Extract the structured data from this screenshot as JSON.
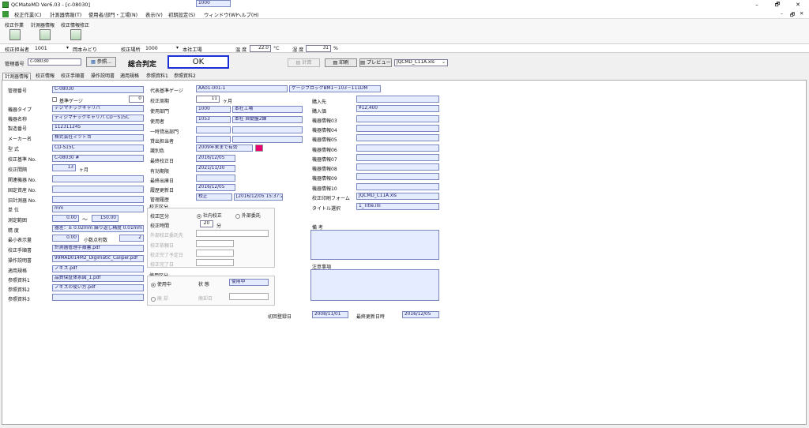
{
  "window": {
    "title": "QCMateMD Ver6.03 - [c-08030]",
    "controls": [
      "–",
      "🗗",
      "✕"
    ],
    "inner_controls": [
      "–",
      "🗗",
      "✕"
    ]
  },
  "menu": [
    "校正作業(C)",
    "計測器情報(T)",
    "使用者/部門・工場(N)",
    "表示(V)",
    "初期設定(S)",
    "ウィンドウ(W)",
    "ヘルプ(H)"
  ],
  "toolbar_tabs": [
    "校正作業",
    "計測器情報",
    "校正情報修正"
  ],
  "status": {
    "operator_label": "校正担当者",
    "operator_id": "1001",
    "operator_name": "岡本みどり",
    "place_label": "校正場所",
    "place_id": "1000",
    "place_name": "本社工場",
    "temp_label": "温 度",
    "temp_value": "22.0",
    "temp_unit": "°C",
    "humidity_label": "湿 度",
    "humidity_value": "31",
    "humidity_unit": "%"
  },
  "header": {
    "mgmt_no_label": "管理番号",
    "mgmt_no_value": "c-08030",
    "ref_button": "参照...",
    "judgment_label": "総合判定",
    "judgment_value": "OK",
    "calc_button": "計算",
    "print_button": "印刷",
    "preview_button": "プレビュー",
    "form_select": "JQCMD_C11A.xls"
  },
  "tabs": [
    "計測器情報",
    "校正情報",
    "校正手順書",
    "操作説明書",
    "適用規格",
    "参照資料1",
    "参照資料2"
  ],
  "left": {
    "mgmt_no": {
      "label": "管理番号",
      "value": "C-08030"
    },
    "master_gauge": {
      "label": "基準ゲージ",
      "value": "0"
    },
    "type": {
      "label": "機器タイプ",
      "value": "デジマチックキャリパ"
    },
    "name": {
      "label": "機器名称",
      "value": "ディジマチックキャリパ CD－S15C"
    },
    "serial": {
      "label": "製造番号",
      "value": "112311245"
    },
    "maker": {
      "label": "メーカー名",
      "value": "株式会社ミツトヨ"
    },
    "model": {
      "label": "型 式",
      "value": "CD-S15C"
    },
    "std_no": {
      "label": "校正基準 No.",
      "value": "C-08030 #"
    },
    "interval": {
      "label": "校正間隔",
      "value": "13",
      "unit": "ヶ月"
    },
    "related": {
      "label": "関連機器 No.",
      "value": ""
    },
    "asset": {
      "label": "固定資産 No.",
      "value": ""
    },
    "old_no": {
      "label": "旧計測器 No.",
      "value": ""
    },
    "unit": {
      "label": "単 位",
      "value": "mm"
    },
    "range": {
      "label": "測定範囲",
      "from": "0.00",
      "sep": "～",
      "to": "150.00"
    },
    "accuracy": {
      "label": "精 度",
      "value": "器差：± 0.02mm 繰り返し精度 0.01mm"
    },
    "min_disp": {
      "label": "最小表示量",
      "value": "0.00",
      "dec_label": "小数点桁数",
      "dec_value": "2"
    },
    "procedure": {
      "label": "校正手順書",
      "value": "計測器管理手順書.pdf"
    },
    "manual": {
      "label": "操作説明書",
      "value": "99MAD014M2_Digimatic_Caliper.pdf"
    },
    "standard": {
      "label": "適用規格",
      "value": "ノギス.pdf"
    },
    "ref1": {
      "label": "参照資料1",
      "value": "品質保証体系図_1.pdf"
    },
    "ref2": {
      "label": "参照資料2",
      "value": "ノギスの使い方.pdf"
    },
    "ref3": {
      "label": "参照資料3",
      "value": ""
    }
  },
  "middle": {
    "rep_gauge": {
      "label": "代表基準ゲージ",
      "value": "AA01-001-1",
      "value2": "ゲージブロックBM1－103－111DM"
    },
    "cal_period": {
      "label": "校正周期",
      "value": "11",
      "unit": "ヶ月"
    },
    "dept": {
      "label": "使用部門",
      "id": "1000",
      "name": "本社工場"
    },
    "user": {
      "label": "使用者",
      "id": "1053",
      "name": "本社 自動盤2課"
    },
    "lend_dept": {
      "label": "一時貸出部門"
    },
    "lend_person": {
      "label": "貸出担当者"
    },
    "ident_color": {
      "label": "識別色",
      "value": "2009年末まで有効",
      "color": "#e8006e"
    },
    "last_cal": {
      "label": "最終校正日",
      "value": "2016/12/05"
    },
    "expiry": {
      "label": "有効期限",
      "value": "2021/11/30"
    },
    "last_out": {
      "label": "最終出庫日",
      "value": ""
    },
    "history_update": {
      "label": "履歴更新日",
      "value": "2016/12/05"
    },
    "history": {
      "label": "管理履歴",
      "value": "校正",
      "value2": "[2016/12/05 15:37:24] 初回訪…"
    },
    "cal_group": {
      "title": "校正区分",
      "kind_label": "校正区分",
      "opt_internal": "社内校正",
      "opt_external": "外部委託",
      "time_label": "校正時間",
      "time_value": "20",
      "time_unit": "分",
      "ext_contractor": "外部校正委託先",
      "ordered": "校正依頼日",
      "due": "校正完了予定日",
      "done": "校正完了日"
    },
    "use_group": {
      "title": "使用区分",
      "opt_use": "使用中",
      "state_label": "状 態",
      "state_value": "使用中",
      "opt_disposed": "廃 却",
      "disposed_label": "廃却日"
    },
    "first_reg": {
      "label": "初回登録日",
      "value": "2008/11/01"
    },
    "last_update": {
      "label": "最終更新日時",
      "value": "2016/12/05"
    }
  },
  "right": {
    "dest": {
      "label": "購入先"
    },
    "price": {
      "label": "購入価",
      "value": "¥12,400"
    },
    "info": [
      "機器情報03",
      "機器情報04",
      "機器情報05",
      "機器情報06",
      "機器情報07",
      "機器情報08",
      "機器情報09",
      "機器情報10"
    ],
    "form": {
      "label": "校正印刷フォーム",
      "value": "JQCMD_C11A.xls"
    },
    "title_sel": {
      "label": "タイトル選択",
      "value": "1_Title.ini"
    },
    "memo_label": "備 考",
    "notes_label": "注意事項"
  }
}
